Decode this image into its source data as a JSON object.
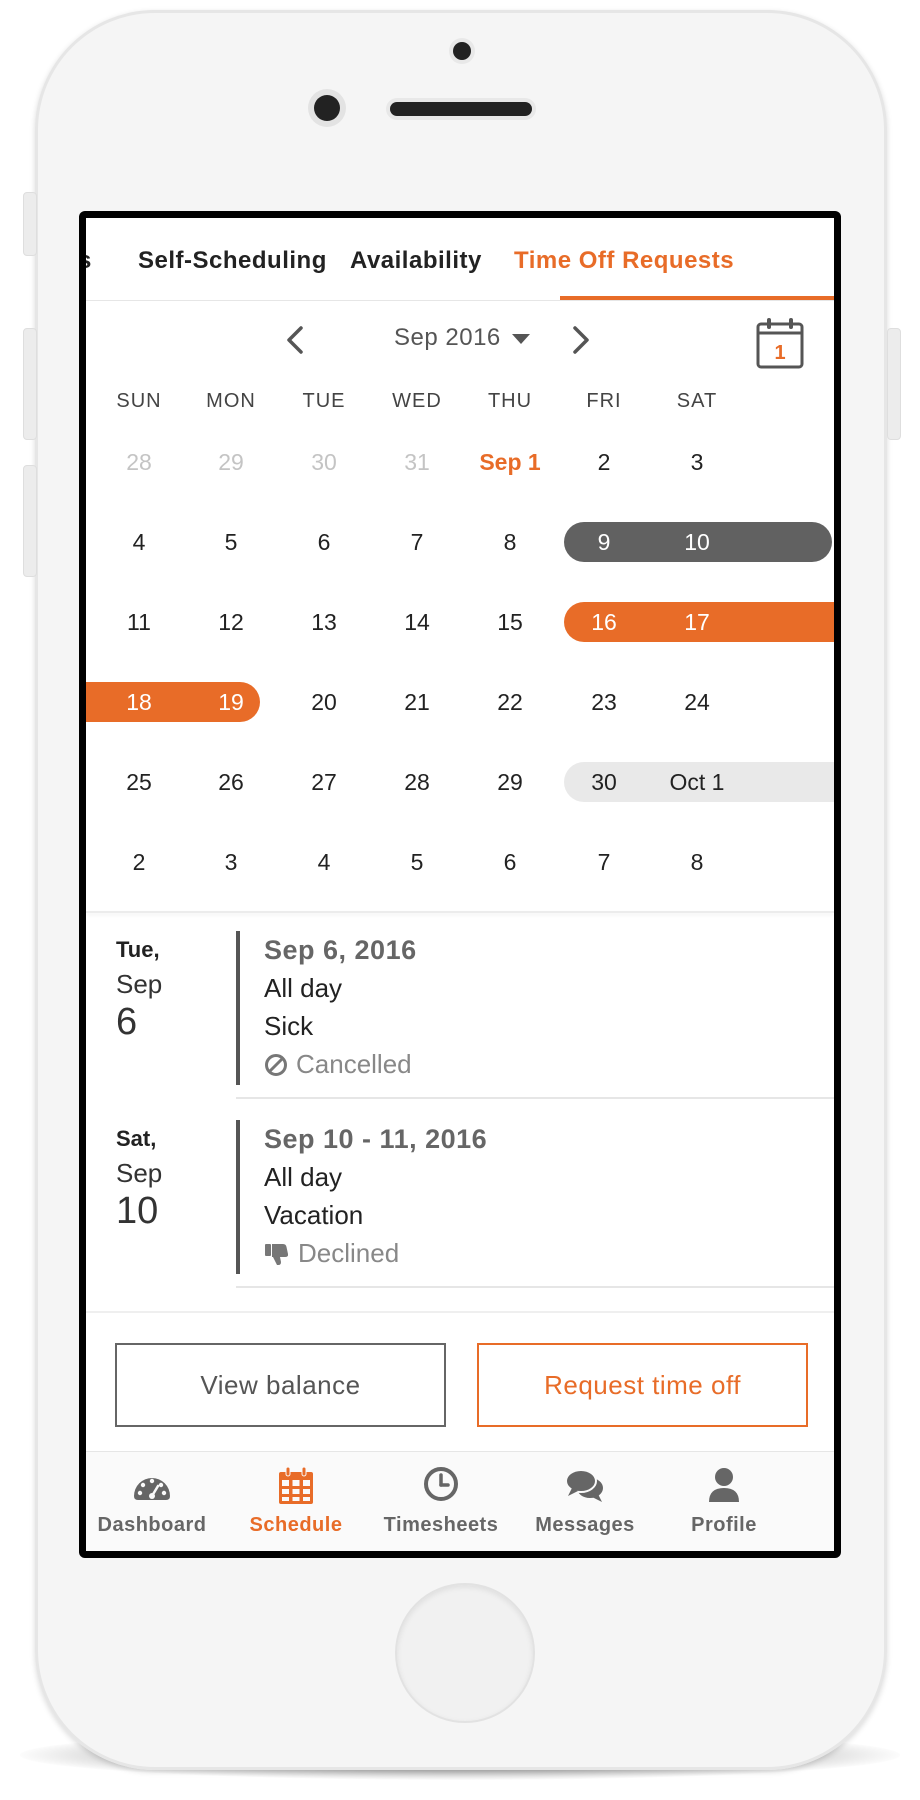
{
  "tabs": [
    {
      "label": "s"
    },
    {
      "label": "Self-Scheduling"
    },
    {
      "label": "Availability"
    },
    {
      "label": "Time Off Requests",
      "active": true
    }
  ],
  "calendar": {
    "month_label": "Sep 2016",
    "calendar_icon_day": "1",
    "weekdays": [
      "SUN",
      "MON",
      "TUE",
      "WED",
      "THU",
      "FRI",
      "SAT"
    ],
    "weeks": [
      [
        "28",
        "29",
        "30",
        "31",
        "Sep 1",
        "2",
        "3"
      ],
      [
        "4",
        "5",
        "6",
        "7",
        "8",
        "9",
        "10"
      ],
      [
        "11",
        "12",
        "13",
        "14",
        "15",
        "16",
        "17"
      ],
      [
        "18",
        "19",
        "20",
        "21",
        "22",
        "23",
        "24"
      ],
      [
        "25",
        "26",
        "27",
        "28",
        "29",
        "30",
        "Oct 1"
      ],
      [
        "2",
        "3",
        "4",
        "5",
        "6",
        "7",
        "8"
      ]
    ]
  },
  "events": [
    {
      "dow": "Tue,",
      "month": "Sep",
      "day": "6",
      "range": "Sep 6, 2016",
      "time": "All day",
      "type": "Sick",
      "status": "Cancelled",
      "status_icon": "cancel-circle-icon"
    },
    {
      "dow": "Sat,",
      "month": "Sep",
      "day": "10",
      "range": "Sep 10 - 11, 2016",
      "time": "All day",
      "type": "Vacation",
      "status": "Declined",
      "status_icon": "thumbs-down-icon"
    }
  ],
  "actions": {
    "view_balance": "View balance",
    "request_time_off": "Request time off"
  },
  "nav": [
    {
      "label": "Dashboard",
      "icon": "dashboard-icon"
    },
    {
      "label": "Schedule",
      "icon": "calendar-icon",
      "active": true
    },
    {
      "label": "Timesheets",
      "icon": "clock-icon"
    },
    {
      "label": "Messages",
      "icon": "chat-bubbles-icon"
    },
    {
      "label": "Profile",
      "icon": "user-icon"
    }
  ],
  "colors": {
    "accent": "#e86c28",
    "dark_pill": "#616161",
    "light_pill": "#e9e9e9"
  }
}
